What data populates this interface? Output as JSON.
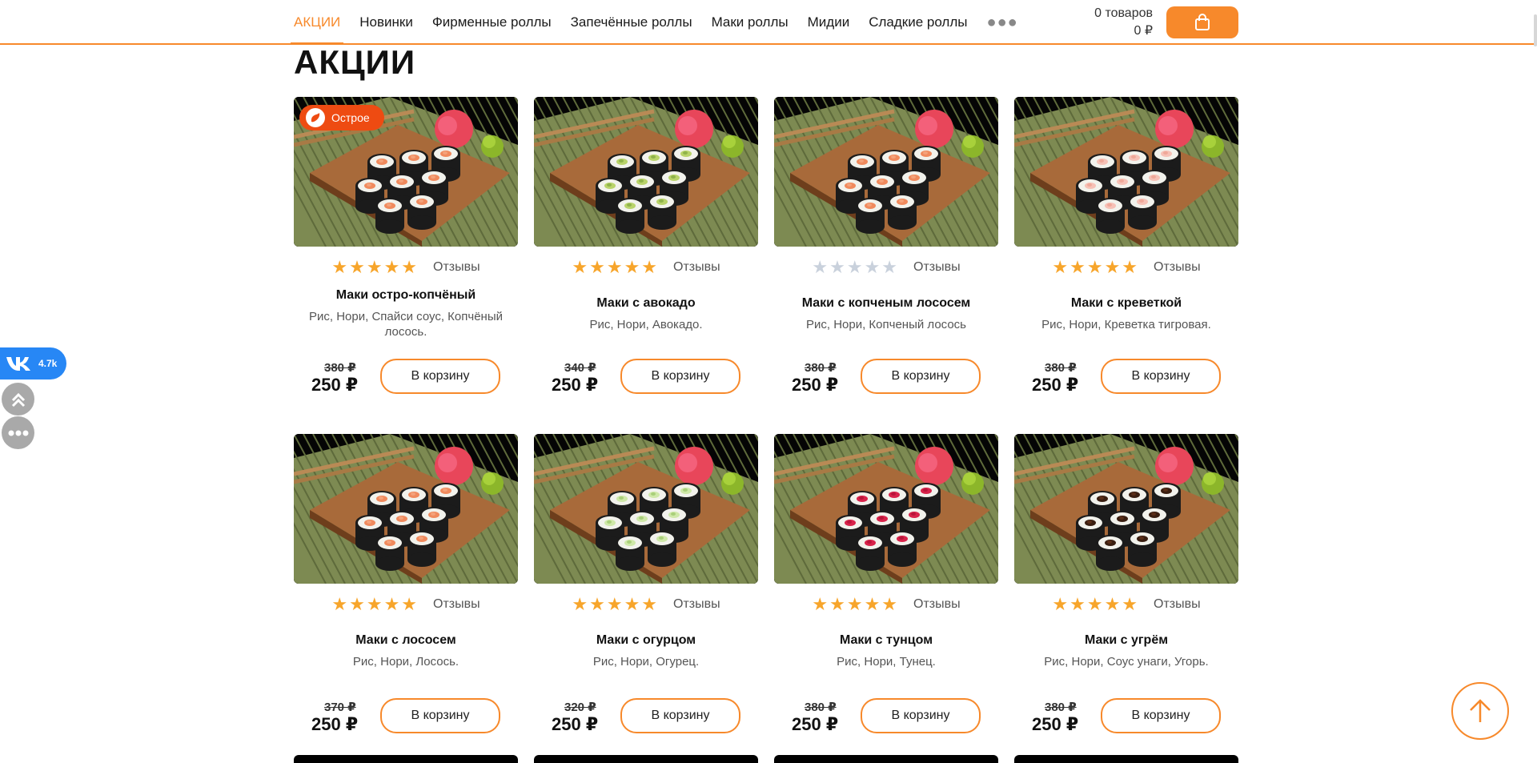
{
  "nav": {
    "items": [
      "АКЦИИ",
      "Новинки",
      "Фирменные роллы",
      "Запечённые роллы",
      "Маки роллы",
      "Мидии",
      "Сладкие роллы"
    ],
    "more_icon": "more-dots-icon"
  },
  "cart": {
    "count_text": "0 товаров",
    "total_text": "0 ₽",
    "icon": "shopping-bag-icon"
  },
  "page_title": "АКЦИИ",
  "colors": {
    "accent": "#f7892b",
    "badge": "#ee4b12",
    "vk": "#2787f5",
    "star": "#f7a52b"
  },
  "products": [
    {
      "name": "Маки остро-копчёный",
      "desc": "Рис, Нори, Спайси соус, Копчёный лосось.",
      "old_price": "380 ₽",
      "price": "250 ₽",
      "stars": 5,
      "reviews": "Отзывы",
      "button": "В корзину",
      "badge": "Острое",
      "filling": "salmon"
    },
    {
      "name": "Маки с авокадо",
      "desc": "Рис, Нори, Авокадо.",
      "old_price": "340 ₽",
      "price": "250 ₽",
      "stars": 5,
      "reviews": "Отзывы",
      "button": "В корзину",
      "badge": "",
      "filling": "avocado"
    },
    {
      "name": "Маки с копченым лососем",
      "desc": "Рис, Нори, Копченый лосось",
      "old_price": "380 ₽",
      "price": "250 ₽",
      "stars": 0,
      "reviews": "Отзывы",
      "button": "В корзину",
      "badge": "",
      "filling": "salmon"
    },
    {
      "name": "Маки с креветкой",
      "desc": "Рис, Нори, Креветка тигровая.",
      "old_price": "380 ₽",
      "price": "250 ₽",
      "stars": 5,
      "reviews": "Отзывы",
      "button": "В корзину",
      "badge": "",
      "filling": "shrimp"
    },
    {
      "name": "Маки с лососем",
      "desc": "Рис, Нори, Лосось.",
      "old_price": "370 ₽",
      "price": "250 ₽",
      "stars": 5,
      "reviews": "Отзывы",
      "button": "В корзину",
      "badge": "",
      "filling": "salmon"
    },
    {
      "name": "Маки с огурцом",
      "desc": "Рис, Нори, Огурец.",
      "old_price": "320 ₽",
      "price": "250 ₽",
      "stars": 5,
      "reviews": "Отзывы",
      "button": "В корзину",
      "badge": "",
      "filling": "cucumber"
    },
    {
      "name": "Маки с тунцом",
      "desc": "Рис, Нори, Тунец.",
      "old_price": "380 ₽",
      "price": "250 ₽",
      "stars": 5,
      "reviews": "Отзывы",
      "button": "В корзину",
      "badge": "",
      "filling": "tuna"
    },
    {
      "name": "Маки с угрём",
      "desc": "Рис, Нори, Соус унаги, Угорь.",
      "old_price": "380 ₽",
      "price": "250 ₽",
      "stars": 5,
      "reviews": "Отзывы",
      "button": "В корзину",
      "badge": "",
      "filling": "eel"
    }
  ],
  "side": {
    "vk_count": "4.7k",
    "vk_icon": "vk-logo-icon",
    "up_icon": "double-chevron-up-icon",
    "more_icon": "more-dots-icon"
  },
  "scroll_top_icon": "arrow-up-icon"
}
